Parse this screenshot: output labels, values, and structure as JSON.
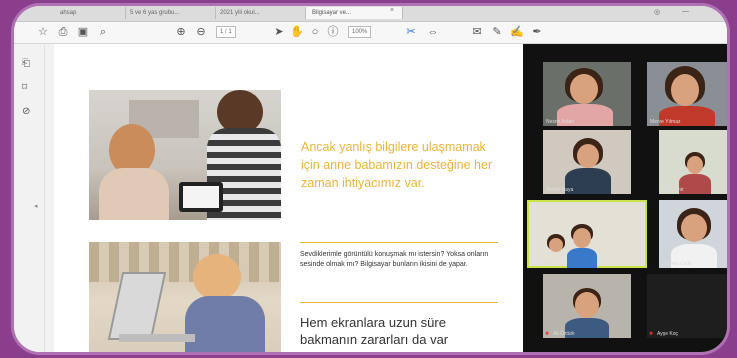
{
  "tabs": [
    {
      "label": "ahsap"
    },
    {
      "label": "5 ve 6 yas grubu..."
    },
    {
      "label": "2021 yili okul..."
    },
    {
      "label": "Bilgisayar ve..."
    }
  ],
  "toolbar": {
    "zoom_value": "100%",
    "page_indicator": "1 / 1"
  },
  "page": {
    "yellow_text": "Ancak yanlış bilgilere ulaşmamak için anne babamızın desteğine her zaman ihtiyacımız var.",
    "small_text": "Sevdiklerimle görüntülü konuşmak mı istersin? Yoksa onların sesinde olmak mı? Bilgisayar bunların ikisini de yapar.",
    "big_text": "Hem ekranlara uzun süre bakmanın zararları da var"
  },
  "video": {
    "participants": [
      {
        "name": "Nesrin Aslan",
        "active": false
      },
      {
        "name": "Merve Yılmaz",
        "active": false
      },
      {
        "name": "Ahmet Kaya",
        "active": false
      },
      {
        "name": "Elif Demir",
        "active": false
      },
      {
        "name": "Yusuf Şahin",
        "active": true
      },
      {
        "name": "Zeynep Çelik",
        "active": false
      },
      {
        "name": "Ali Öztürk",
        "active": false
      },
      {
        "name": "Ayşe Koç",
        "active": false
      }
    ]
  },
  "colors": {
    "accent_yellow": "#e8b53a",
    "background_purple": "#8a3f8c",
    "active_speaker": "#c9e34a"
  }
}
